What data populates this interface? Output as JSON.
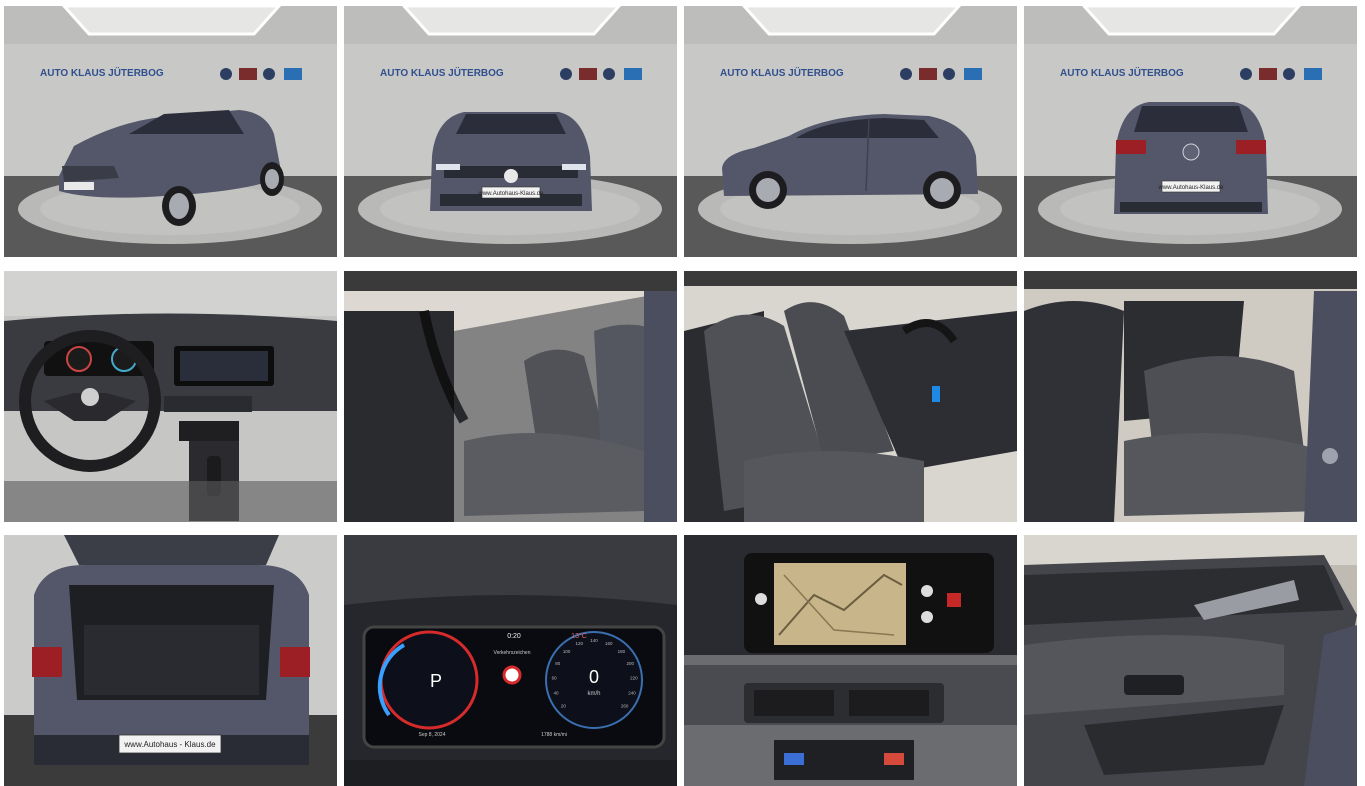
{
  "showroom": {
    "sign": "AUTO KLAUS JÜTERBOG"
  },
  "plates": {
    "front": "www.Autohaus-Klaus.de",
    "rear": "www.Autohaus-Klaus.de",
    "trunk": "www.Autohaus - Klaus.de"
  },
  "cluster": {
    "time": "0:20",
    "temp": "13°C",
    "gear": "P",
    "speed": "0",
    "speed_unit": "km/h",
    "center_label": "Verkehrszeichen",
    "date": "Sep 8, 2024",
    "odometer": "1788 km/mi",
    "ticks": [
      "20",
      "40",
      "60",
      "80",
      "100",
      "120",
      "140",
      "160",
      "180",
      "200",
      "220",
      "240",
      "260"
    ]
  },
  "colors": {
    "car_paint": "#545769",
    "wall": "#c9c9c7",
    "floor": "#5a5a5a",
    "turntable": "#b8b8b6",
    "interior_dark": "#2a2b2f",
    "seat_fabric": "#505257",
    "cluster_red": "#d62b2b",
    "cluster_blue": "#3aa0ff"
  }
}
